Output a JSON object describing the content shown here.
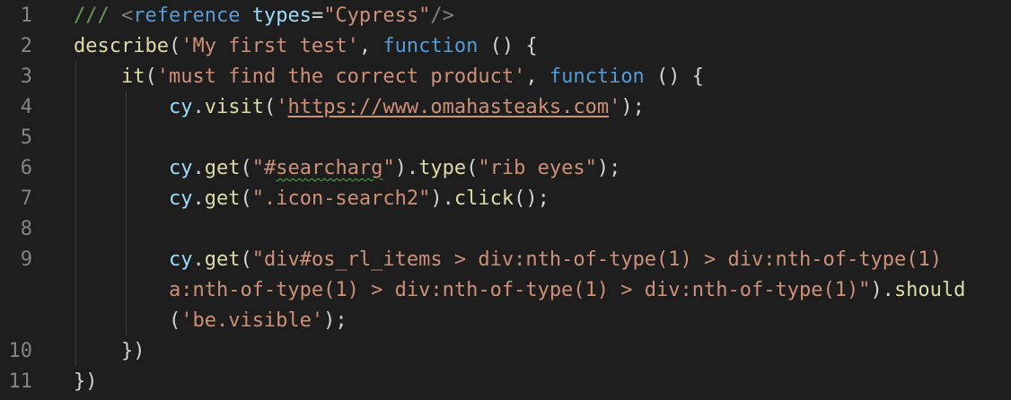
{
  "editor": {
    "lines": [
      {
        "num": "1",
        "parts": [
          {
            "t": "/// ",
            "c": "c"
          },
          {
            "t": "<",
            "c": "tag"
          },
          {
            "t": "reference",
            "c": "k"
          },
          {
            "t": " ",
            "c": "p"
          },
          {
            "t": "types",
            "c": "v"
          },
          {
            "t": "=",
            "c": "p"
          },
          {
            "t": "\"Cypress\"",
            "c": "s"
          },
          {
            "t": "/>",
            "c": "tag"
          }
        ]
      },
      {
        "num": "2",
        "parts": [
          {
            "t": "describe",
            "c": "f"
          },
          {
            "t": "(",
            "c": "p"
          },
          {
            "t": "'My first test'",
            "c": "s"
          },
          {
            "t": ", ",
            "c": "p"
          },
          {
            "t": "function",
            "c": "k"
          },
          {
            "t": " () {",
            "c": "p"
          }
        ]
      },
      {
        "num": "3",
        "parts": [
          {
            "t": "    ",
            "c": "p"
          },
          {
            "t": "it",
            "c": "f"
          },
          {
            "t": "(",
            "c": "p"
          },
          {
            "t": "'must find the correct product'",
            "c": "s"
          },
          {
            "t": ", ",
            "c": "p"
          },
          {
            "t": "function",
            "c": "k"
          },
          {
            "t": " () {",
            "c": "p"
          }
        ]
      },
      {
        "num": "4",
        "parts": [
          {
            "t": "        ",
            "c": "p"
          },
          {
            "t": "cy",
            "c": "v"
          },
          {
            "t": ".",
            "c": "p"
          },
          {
            "t": "visit",
            "c": "f"
          },
          {
            "t": "(",
            "c": "p"
          },
          {
            "t": "'",
            "c": "s"
          },
          {
            "t": "https://www.omahasteaks.com",
            "c": "s",
            "u": true
          },
          {
            "t": "'",
            "c": "s"
          },
          {
            "t": ");",
            "c": "p"
          }
        ]
      },
      {
        "num": "5",
        "parts": []
      },
      {
        "num": "6",
        "parts": [
          {
            "t": "        ",
            "c": "p"
          },
          {
            "t": "cy",
            "c": "v"
          },
          {
            "t": ".",
            "c": "p"
          },
          {
            "t": "get",
            "c": "f"
          },
          {
            "t": "(",
            "c": "p"
          },
          {
            "t": "\"#",
            "c": "s"
          },
          {
            "t": "searcharg",
            "c": "s",
            "w": true
          },
          {
            "t": "\"",
            "c": "s"
          },
          {
            "t": ").",
            "c": "p"
          },
          {
            "t": "type",
            "c": "f"
          },
          {
            "t": "(",
            "c": "p"
          },
          {
            "t": "\"rib eyes\"",
            "c": "s"
          },
          {
            "t": ");",
            "c": "p"
          }
        ]
      },
      {
        "num": "7",
        "parts": [
          {
            "t": "        ",
            "c": "p"
          },
          {
            "t": "cy",
            "c": "v"
          },
          {
            "t": ".",
            "c": "p"
          },
          {
            "t": "get",
            "c": "f"
          },
          {
            "t": "(",
            "c": "p"
          },
          {
            "t": "\".icon-search2\"",
            "c": "s"
          },
          {
            "t": ").",
            "c": "p"
          },
          {
            "t": "click",
            "c": "f"
          },
          {
            "t": "();",
            "c": "p"
          }
        ]
      },
      {
        "num": "8",
        "parts": []
      },
      {
        "num": "9",
        "parts": [
          {
            "t": "        ",
            "c": "p"
          },
          {
            "t": "cy",
            "c": "v"
          },
          {
            "t": ".",
            "c": "p"
          },
          {
            "t": "get",
            "c": "f"
          },
          {
            "t": "(",
            "c": "p"
          },
          {
            "t": "\"div#os_rl_items > div:nth-of-type(1) > div:nth-of-type(1)",
            "c": "s"
          }
        ]
      },
      {
        "num": "",
        "parts": [
          {
            "t": "        ",
            "c": "p"
          },
          {
            "t": "a:nth-of-type(1) > div:nth-of-type(1) > div:nth-of-type(1)\"",
            "c": "s"
          },
          {
            "t": ").",
            "c": "p"
          },
          {
            "t": "should",
            "c": "f"
          }
        ]
      },
      {
        "num": "",
        "parts": [
          {
            "t": "        ",
            "c": "p"
          },
          {
            "t": "(",
            "c": "p"
          },
          {
            "t": "'be.visible'",
            "c": "s"
          },
          {
            "t": ");",
            "c": "p"
          }
        ]
      },
      {
        "num": "10",
        "parts": [
          {
            "t": "    })",
            "c": "p"
          }
        ]
      },
      {
        "num": "11",
        "parts": [
          {
            "t": "})",
            "c": "p"
          }
        ]
      }
    ]
  }
}
